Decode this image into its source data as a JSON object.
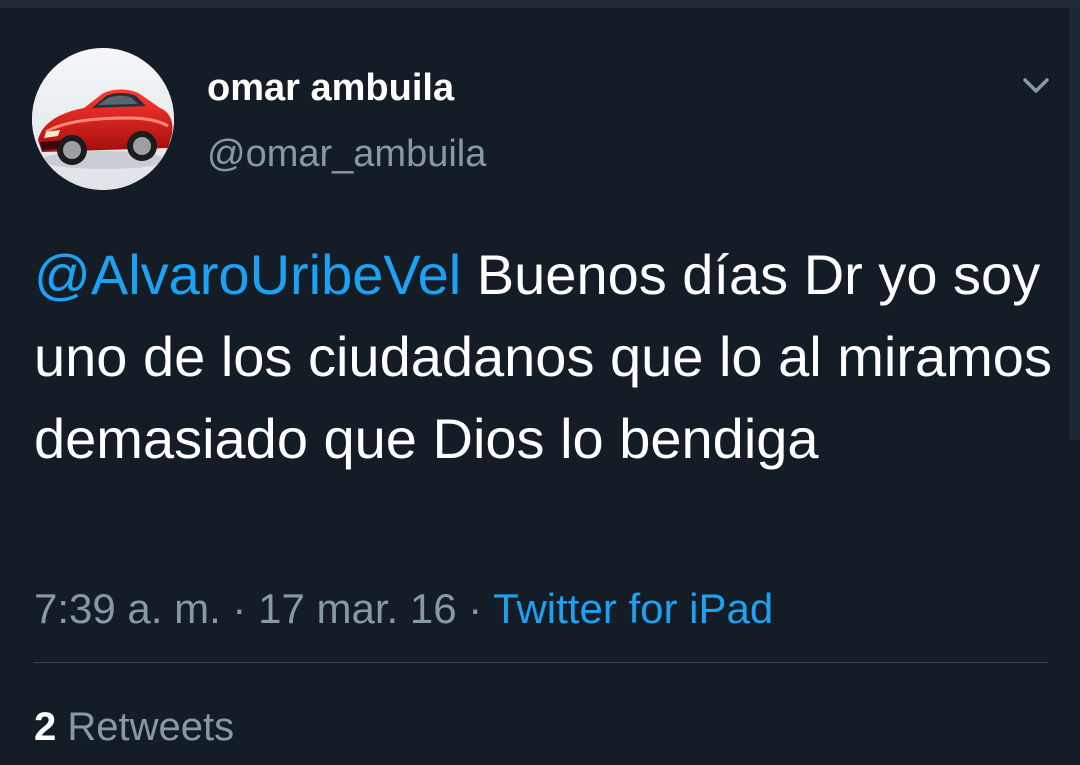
{
  "theme": {
    "background": "#141d26",
    "text": "#ffffff",
    "secondary": "#8899a6",
    "link": "#1da1f2",
    "divider": "#38444d"
  },
  "author": {
    "display_name": "omar ambuila",
    "handle": "@omar_ambuila",
    "avatar_icon": "red-sports-car-avatar"
  },
  "tweet": {
    "mention": "@AlvaroUribeVel",
    "body": " Buenos días Dr yo soy uno de los ciudadanos que lo al miramos demasiado que Dios lo bendiga"
  },
  "meta": {
    "time": "7:39 a. m.",
    "separator_1": " · ",
    "date": "17 mar. 16",
    "separator_2": " · ",
    "source": "Twitter for iPad"
  },
  "stats": {
    "retweet_count": "2",
    "retweet_label": "Retweets"
  },
  "icons": {
    "more_menu": "chevron-down-icon"
  }
}
